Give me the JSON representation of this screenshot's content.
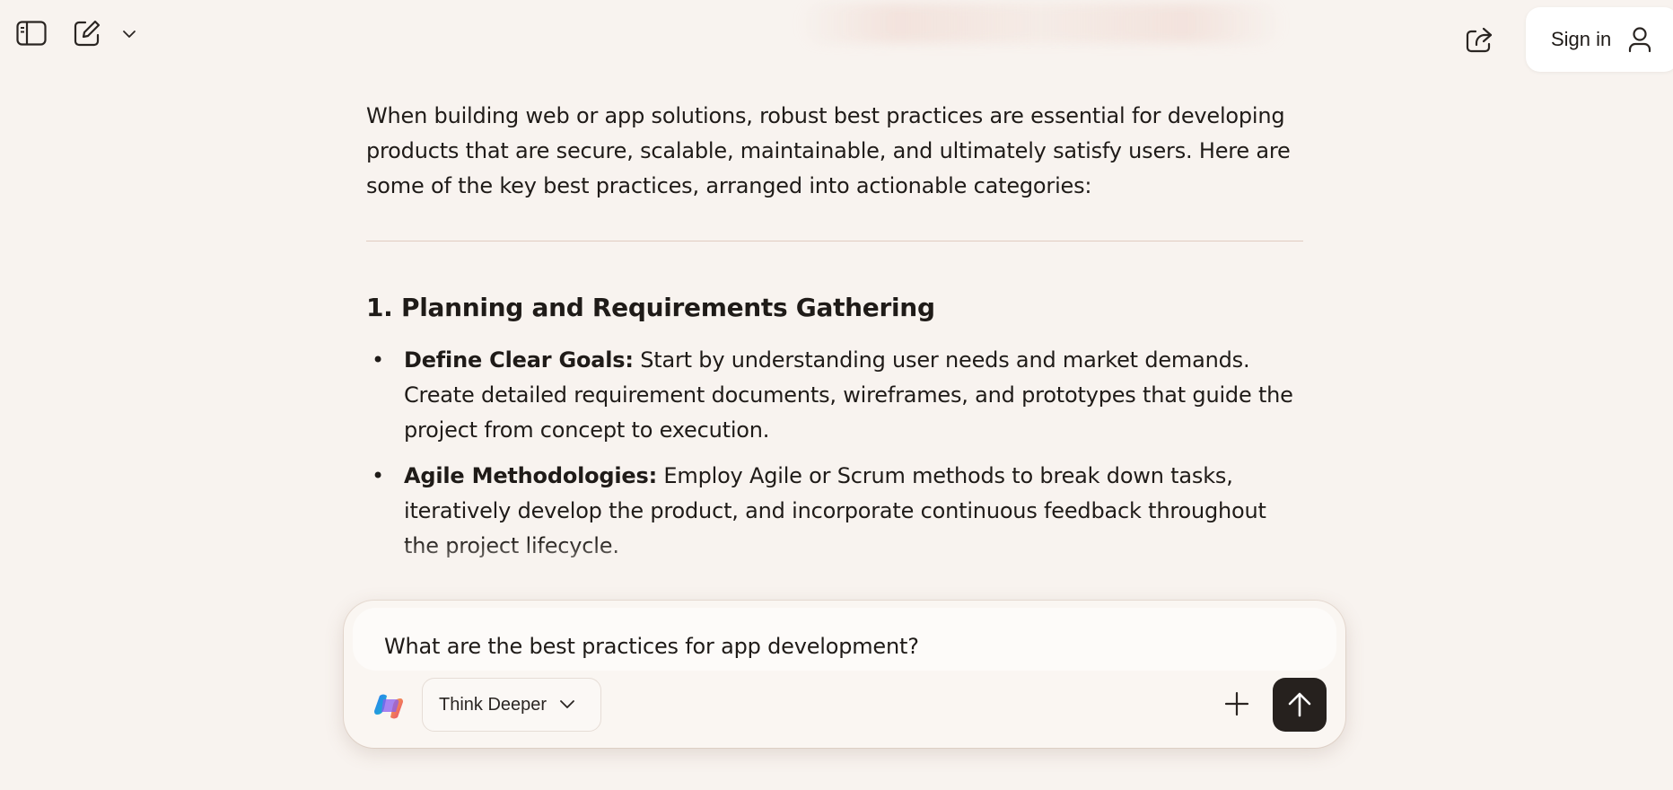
{
  "topbar": {
    "sidebar_toggle_icon": "sidebar-icon",
    "new_chat_icon": "compose-icon",
    "dropdown_icon": "chevron-down-icon",
    "share_icon": "share-icon",
    "signin_label": "Sign in",
    "user_icon": "user-icon"
  },
  "message": {
    "intro": "When building web or app solutions, robust best practices are essential for developing products that are secure, scalable, maintainable, and ultimately satisfy users. Here are some of the key best practices, arranged into actionable categories:",
    "section": {
      "heading": "1. Planning and Requirements Gathering",
      "items": [
        {
          "title": "Define Clear Goals:",
          "text": " Start by understanding user needs and market demands. Create detailed requirement documents, wireframes, and prototypes that guide the project from concept to execution."
        },
        {
          "title": "Agile Methodologies:",
          "text": " Employ Agile or Scrum methods to break down tasks, iteratively develop the product, and incorporate continuous feedback throughout the project lifecycle."
        }
      ]
    }
  },
  "composer": {
    "input_value": "What are the best practices for app development?",
    "mode_label": "Think Deeper",
    "logo_icon": "copilot-logo-icon",
    "add_icon": "plus-icon",
    "send_icon": "arrow-up-icon"
  },
  "colors": {
    "background": "#f8f3ef",
    "send_button": "#26211e",
    "text": "#1f1b18"
  }
}
